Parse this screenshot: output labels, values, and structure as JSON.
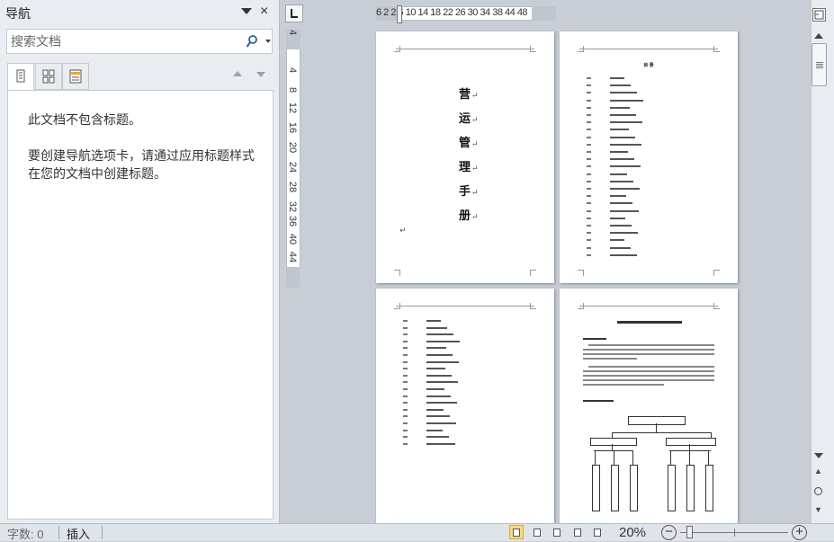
{
  "nav_pane": {
    "title": "导航",
    "close_label": "×",
    "search_placeholder": "搜索文档",
    "message_line1": "此文档不包含标题。",
    "message_line2": "要创建导航选项卡，请通过应用标题样式在您的文档中创建标题。"
  },
  "ruler": {
    "horizontal": "6 2 2 6 10 14 18 22 26 30 34 38 44 48",
    "vertical": [
      "4",
      "4",
      "8",
      "12",
      "16",
      "20",
      "24",
      "28",
      "32",
      "36",
      "40",
      "44"
    ]
  },
  "document": {
    "cover_title_chars": [
      "营",
      "运",
      "管",
      "理",
      "手",
      "册"
    ],
    "pilcrow": "↵",
    "toc_heading": "目 录"
  },
  "status_bar": {
    "word_count": "字数: 0",
    "insert_mode": "插入",
    "zoom_percent": "20%",
    "zoom_out_label": "−",
    "zoom_in_label": "+",
    "zoom_level": 0.2
  },
  "colors": {
    "active_view": "#fcd97e",
    "background": "#c9ced6",
    "pane": "#e9edf2"
  },
  "icons": [
    "menu-arrow-icon",
    "close-icon",
    "search-icon",
    "headings-tab-icon",
    "pages-tab-icon",
    "results-tab-icon",
    "ruler-toggle-icon"
  ]
}
